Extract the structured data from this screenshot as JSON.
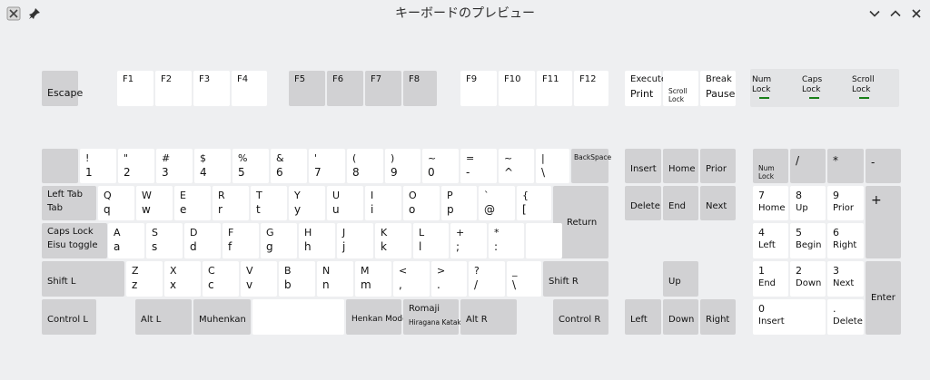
{
  "window": {
    "title": "キーボードのプレビュー"
  },
  "indicators": [
    {
      "l1": "Num",
      "l2": "Lock",
      "led": "on"
    },
    {
      "l1": "Caps",
      "l2": "Lock",
      "led": "on"
    },
    {
      "l1": "Scroll",
      "l2": "Lock",
      "led": "on"
    }
  ],
  "keys": {
    "esc": "Escape",
    "f1": "F1",
    "f2": "F2",
    "f3": "F3",
    "f4": "F4",
    "f5": "F5",
    "f6": "F6",
    "f7": "F7",
    "f8": "F8",
    "f9": "F9",
    "f10": "F10",
    "f11": "F11",
    "f12": "F12",
    "print_top": "Execute",
    "print_bottom": "Print",
    "scroll_top": "Scroll",
    "scroll_bottom": "Lock",
    "break_top": "Break",
    "break_bottom": "Pause",
    "n1": [
      "!",
      "1"
    ],
    "n2": [
      "\"",
      "2"
    ],
    "n3": [
      "#",
      "3"
    ],
    "n4": [
      "$",
      "4"
    ],
    "n5": [
      "%",
      "5"
    ],
    "n6": [
      "&",
      "6"
    ],
    "n7": [
      "'",
      "7"
    ],
    "n8": [
      "(",
      "8"
    ],
    "n9": [
      ")",
      "9"
    ],
    "n0": [
      "~",
      "0"
    ],
    "minus": [
      "=",
      "-"
    ],
    "caret": [
      "~",
      "^"
    ],
    "yen": [
      "|",
      "\\"
    ],
    "backspace": "BackSpace",
    "tab_top": "Left Tab",
    "tab_bottom": "Tab",
    "q": [
      "Q",
      "q"
    ],
    "w": [
      "W",
      "w"
    ],
    "e": [
      "E",
      "e"
    ],
    "r": [
      "R",
      "r"
    ],
    "t": [
      "T",
      "t"
    ],
    "y": [
      "Y",
      "y"
    ],
    "u": [
      "U",
      "u"
    ],
    "i": [
      "I",
      "i"
    ],
    "o": [
      "O",
      "o"
    ],
    "p": [
      "P",
      "p"
    ],
    "at": [
      "`",
      "@"
    ],
    "bracket": [
      "{",
      "["
    ],
    "return": "Return",
    "caps_top": "Caps Lock",
    "caps_bottom": "Eisu toggle",
    "a": [
      "A",
      "a"
    ],
    "s": [
      "S",
      "s"
    ],
    "d": [
      "D",
      "d"
    ],
    "f": [
      "F",
      "f"
    ],
    "g": [
      "G",
      "g"
    ],
    "h": [
      "H",
      "h"
    ],
    "j": [
      "J",
      "j"
    ],
    "k": [
      "K",
      "k"
    ],
    "l": [
      "L",
      "l"
    ],
    "semicolon": [
      "+",
      ";"
    ],
    "colon": [
      "*",
      ":"
    ],
    "shift_l": "Shift L",
    "z": [
      "Z",
      "z"
    ],
    "x": [
      "X",
      "x"
    ],
    "c": [
      "C",
      "c"
    ],
    "v": [
      "V",
      "v"
    ],
    "b": [
      "B",
      "b"
    ],
    "n": [
      "N",
      "n"
    ],
    "m": [
      "M",
      "m"
    ],
    "comma": [
      "<",
      ","
    ],
    "period": [
      ">",
      "."
    ],
    "slash": [
      "?",
      "/"
    ],
    "backslash": [
      "_",
      "\\"
    ],
    "shift_r": "Shift R",
    "ctrl_l": "Control L",
    "alt_l": "Alt L",
    "muhenkan": "Muhenkan",
    "henkan": "Henkan Mode",
    "romaji_top": "Romaji",
    "romaji_bottom": "Hiragana Katakana",
    "alt_r": "Alt R",
    "ctrl_r": "Control R",
    "insert": "Insert",
    "home": "Home",
    "prior": "Prior",
    "delete": "Delete",
    "end": "End",
    "next": "Next",
    "up": "Up",
    "left": "Left",
    "down": "Down",
    "right": "Right",
    "kp_numlock_top": "Num",
    "kp_numlock_bottom": "Lock",
    "kp_div": "/",
    "kp_mul": "*",
    "kp_sub": "-",
    "kp_add": "+",
    "kp7": [
      "7",
      "Home"
    ],
    "kp8": [
      "8",
      "Up"
    ],
    "kp9": [
      "9",
      "Prior"
    ],
    "kp4": [
      "4",
      "Left"
    ],
    "kp5": [
      "5",
      "Begin"
    ],
    "kp6": [
      "6",
      "Right"
    ],
    "kp1": [
      "1",
      "End"
    ],
    "kp2": [
      "2",
      "Down"
    ],
    "kp3": [
      "3",
      "Next"
    ],
    "kp0": [
      "0",
      "Insert"
    ],
    "kpdot": [
      ".",
      "Delete"
    ],
    "kp_enter": "Enter"
  }
}
